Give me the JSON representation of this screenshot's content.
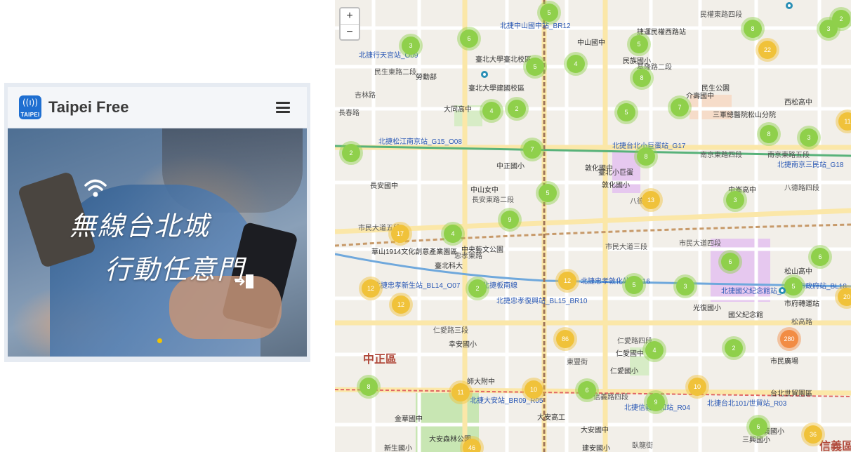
{
  "app": {
    "logo_wave": "((ı))",
    "logo_text": "TAIPEI",
    "title": "Taipei Free"
  },
  "hero": {
    "line1": "無線台北城",
    "line2": "行動任意門"
  },
  "colors": {
    "brand_blue": "#1f6fd1",
    "indicator": "#f2c300",
    "cluster_green": "#8fd04b",
    "cluster_yellow": "#f0c23a",
    "cluster_orange": "#f28c44"
  },
  "map": {
    "zoom_in": "+",
    "zoom_out": "−",
    "clusters": [
      {
        "n": "5",
        "c": "g"
      },
      {
        "n": "3",
        "c": "g"
      },
      {
        "n": "6",
        "c": "g"
      },
      {
        "n": "5",
        "c": "g"
      },
      {
        "n": "4",
        "c": "g"
      },
      {
        "n": "5",
        "c": "g"
      },
      {
        "n": "8",
        "c": "g"
      },
      {
        "n": "22",
        "c": "y"
      },
      {
        "n": "3",
        "c": "g"
      },
      {
        "n": "2",
        "c": "g"
      },
      {
        "n": "4",
        "c": "g"
      },
      {
        "n": "2",
        "c": "g"
      },
      {
        "n": "5",
        "c": "g"
      },
      {
        "n": "8",
        "c": "g"
      },
      {
        "n": "7",
        "c": "g"
      },
      {
        "n": "8",
        "c": "g"
      },
      {
        "n": "3",
        "c": "g"
      },
      {
        "n": "11",
        "c": "y"
      },
      {
        "n": "7",
        "c": "g"
      },
      {
        "n": "8",
        "c": "g"
      },
      {
        "n": "5",
        "c": "g"
      },
      {
        "n": "13",
        "c": "y"
      },
      {
        "n": "3",
        "c": "g"
      },
      {
        "n": "17",
        "c": "y"
      },
      {
        "n": "4",
        "c": "g"
      },
      {
        "n": "9",
        "c": "g"
      },
      {
        "n": "6",
        "c": "g"
      },
      {
        "n": "6",
        "c": "g"
      },
      {
        "n": "12",
        "c": "y"
      },
      {
        "n": "5",
        "c": "g"
      },
      {
        "n": "2",
        "c": "g"
      },
      {
        "n": "12",
        "c": "y"
      },
      {
        "n": "3",
        "c": "g"
      },
      {
        "n": "5",
        "c": "g"
      },
      {
        "n": "20",
        "c": "y"
      },
      {
        "n": "12",
        "c": "y"
      },
      {
        "n": "86",
        "c": "y"
      },
      {
        "n": "4",
        "c": "g"
      },
      {
        "n": "2",
        "c": "g"
      },
      {
        "n": "280",
        "c": "o"
      },
      {
        "n": "8",
        "c": "g"
      },
      {
        "n": "11",
        "c": "y"
      },
      {
        "n": "10",
        "c": "y"
      },
      {
        "n": "6",
        "c": "g"
      },
      {
        "n": "9",
        "c": "g"
      },
      {
        "n": "10",
        "c": "y"
      },
      {
        "n": "6",
        "c": "g"
      },
      {
        "n": "46",
        "c": "y"
      },
      {
        "n": "36",
        "c": "y"
      },
      {
        "n": "2",
        "c": "g"
      }
    ],
    "labels": [
      {
        "t": "北捷中山國中站_BR12",
        "k": "blue"
      },
      {
        "t": "捷運民權西路站",
        "k": ""
      },
      {
        "t": "民權東路四段",
        "k": "road"
      },
      {
        "t": "基隆路二段",
        "k": "road"
      },
      {
        "t": "民生東路二段",
        "k": "road"
      },
      {
        "t": "北捷行天宮站_O09",
        "k": "blue"
      },
      {
        "t": "中山國中",
        "k": ""
      },
      {
        "t": "臺北大學臺北校區",
        "k": ""
      },
      {
        "t": "吉林路",
        "k": "road"
      },
      {
        "t": "勞動部",
        "k": ""
      },
      {
        "t": "臺北大學建國校區",
        "k": ""
      },
      {
        "t": "大同高中",
        "k": ""
      },
      {
        "t": "長春路",
        "k": "road"
      },
      {
        "t": "民族國小",
        "k": ""
      },
      {
        "t": "介壽國中",
        "k": ""
      },
      {
        "t": "民生公園",
        "k": ""
      },
      {
        "t": "三軍總醫院松山分院",
        "k": ""
      },
      {
        "t": "西松高中",
        "k": ""
      },
      {
        "t": "北捷松江南京站_G15_O08",
        "k": "blue"
      },
      {
        "t": "北捷台北小巨蛋站_G17",
        "k": "blue"
      },
      {
        "t": "南京東路四段",
        "k": "road"
      },
      {
        "t": "南京東路五段",
        "k": "road"
      },
      {
        "t": "北捷南京三民站_G18",
        "k": "blue"
      },
      {
        "t": "中正國小",
        "k": ""
      },
      {
        "t": "長安國中",
        "k": ""
      },
      {
        "t": "中山女中",
        "k": ""
      },
      {
        "t": "敦化國中",
        "k": ""
      },
      {
        "t": "臺北小巨蛋",
        "k": ""
      },
      {
        "t": "敦化國小",
        "k": ""
      },
      {
        "t": "長安東路二段",
        "k": "road"
      },
      {
        "t": "八德路",
        "k": "road"
      },
      {
        "t": "中崙高中",
        "k": ""
      },
      {
        "t": "八德路四段",
        "k": "road"
      },
      {
        "t": "市民大道五段",
        "k": "road"
      },
      {
        "t": "中央藝文公園",
        "k": ""
      },
      {
        "t": "市民大道三段",
        "k": "road"
      },
      {
        "t": "市民大道四段",
        "k": "road"
      },
      {
        "t": "華山1914文化創意產業園區",
        "k": ""
      },
      {
        "t": "忠孝東路",
        "k": "road"
      },
      {
        "t": "臺北科大",
        "k": ""
      },
      {
        "t": "北捷忠孝新生站_BL14_O07",
        "k": "blue"
      },
      {
        "t": "北捷板南線",
        "k": "blue"
      },
      {
        "t": "北捷忠孝敦化站_BL16",
        "k": "blue"
      },
      {
        "t": "北捷國父紀念館站_BL17",
        "k": "blue"
      },
      {
        "t": "北捷市政府站_BL18",
        "k": "blue"
      },
      {
        "t": "北捷忠孝復興站_BL15_BR10",
        "k": "blue"
      },
      {
        "t": "光復國小",
        "k": ""
      },
      {
        "t": "國父紀念館",
        "k": ""
      },
      {
        "t": "松山高中",
        "k": ""
      },
      {
        "t": "市府轉運站",
        "k": ""
      },
      {
        "t": "松高路",
        "k": "road"
      },
      {
        "t": "仁愛路三段",
        "k": "road"
      },
      {
        "t": "仁愛路四段",
        "k": "road"
      },
      {
        "t": "幸安國小",
        "k": ""
      },
      {
        "t": "仁愛國中",
        "k": ""
      },
      {
        "t": "仁愛國小",
        "k": ""
      },
      {
        "t": "東豐街",
        "k": "road"
      },
      {
        "t": "中正區",
        "k": "district"
      },
      {
        "t": "師大附中",
        "k": ""
      },
      {
        "t": "北捷大安站_BR09_R05",
        "k": "blue"
      },
      {
        "t": "信義路四段",
        "k": "road"
      },
      {
        "t": "北捷信義安和站_R04",
        "k": "blue"
      },
      {
        "t": "北捷台北101/世貿站_R03",
        "k": "blue"
      },
      {
        "t": "信義區",
        "k": "district"
      },
      {
        "t": "金華國中",
        "k": ""
      },
      {
        "t": "大安森林公園",
        "k": ""
      },
      {
        "t": "大安高工",
        "k": ""
      },
      {
        "t": "大安國中",
        "k": ""
      },
      {
        "t": "新生國小",
        "k": ""
      },
      {
        "t": "建安國小",
        "k": ""
      },
      {
        "t": "台北世貿園區",
        "k": ""
      },
      {
        "t": "三興國小",
        "k": ""
      },
      {
        "t": "臥龍街",
        "k": "road"
      },
      {
        "t": "信義國小",
        "k": ""
      },
      {
        "t": "市民廣場",
        "k": ""
      }
    ]
  }
}
